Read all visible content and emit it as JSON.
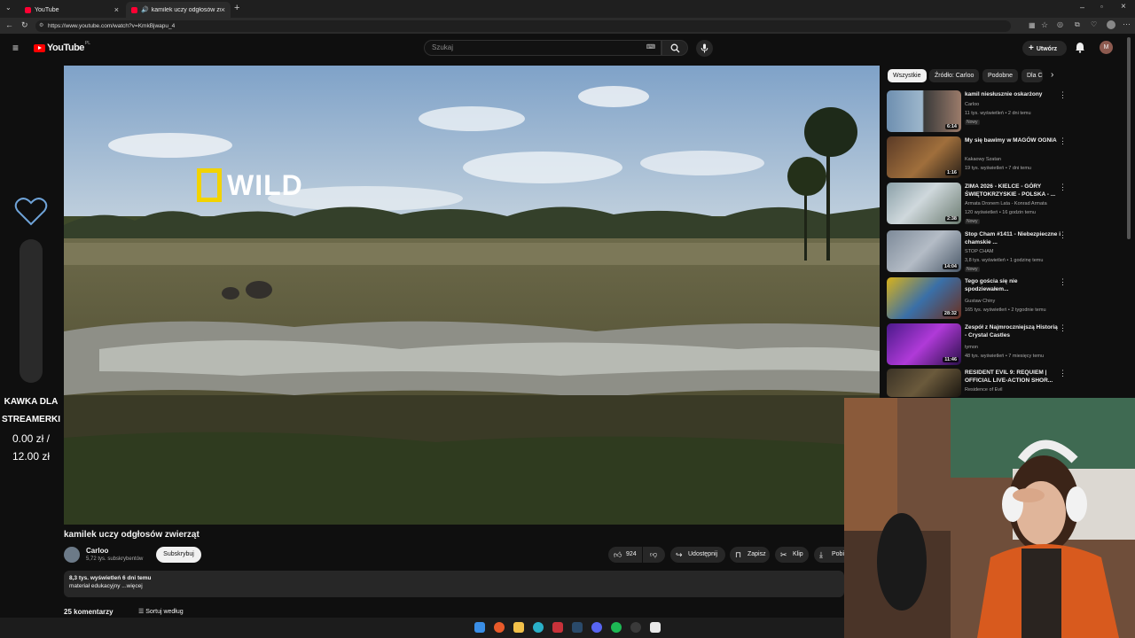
{
  "browser": {
    "tabs": [
      {
        "label": "YouTube"
      },
      {
        "label": "kamilek uczy odgłosów zwierz"
      }
    ],
    "url": "https://www.youtube.com/watch?v=KmkBjwapu_4"
  },
  "header": {
    "logo_text": "YouTube",
    "logo_country": "PL",
    "search_placeholder": "Szukaj",
    "create_label": "Utwórz",
    "avatar_letter": "M"
  },
  "overlay": {
    "line1": "KAWKA DLA",
    "line2": "STREAMERKI",
    "amount": "0.00 zł /",
    "goal": "12.00 zł"
  },
  "video": {
    "watermark": "WILD",
    "title": "kamilek uczy odgłosów zwierząt",
    "channel": "Carloo",
    "subscribers": "5,72 tys. subskrybentów",
    "subscribe_label": "Subskrybuj",
    "likes": "924",
    "share_label": "Udostępnij",
    "save_label": "Zapisz",
    "clip_label": "Klip",
    "download_label": "Pobi",
    "desc_stats": "8,3 tys. wyświetleń  6 dni temu",
    "desc_text": "materiał edukacyjny ...więcej",
    "comments": "25 komentarzy",
    "sort_label": "Sortuj według"
  },
  "chips": [
    "Wszystkie",
    "Źródło: Carloo",
    "Podobne",
    "Dla C"
  ],
  "recommended": [
    {
      "title": "kamil niesłusznie oskarżony",
      "channel": "Carloo",
      "meta": "11 tys. wyświetleń • 2 dni temu",
      "badge": "Nowy",
      "duration": "6:14"
    },
    {
      "title": "My się bawimy w MAGÓW OGNIA",
      "channel": "Kakaowy Szatan",
      "meta": "19 tys. wyświetleń • 7 dni temu",
      "badge": "",
      "duration": "1:16"
    },
    {
      "title": "ZIMA 2026 - KIELCE - GÓRY ŚWIĘTOKRZYSKIE - POLSKA - ...",
      "channel": "Armata Dronem Lata - Konrad Armata",
      "meta": "120 wyświetleń • 16 godzin temu",
      "badge": "Nowy",
      "duration": "2:38"
    },
    {
      "title": "Stop Cham #1411 - Niebezpieczne i chamskie ...",
      "channel": "STOP CHAM",
      "meta": "3,8 tys. wyświetleń • 1 godzinę temu",
      "badge": "Nowy",
      "duration": "14:04"
    },
    {
      "title": "Tego gościa się nie spodziewałem...",
      "channel": "Gustaw Chiny",
      "meta": "165 tys. wyświetleń • 2 tygodnie temu",
      "badge": "",
      "duration": "28:32"
    },
    {
      "title": "Zespół z Najmroczniejszą Historią - Crystal Castles",
      "channel": "tymon",
      "meta": "48 tys. wyświetleń • 7 miesięcy temu",
      "badge": "",
      "duration": "11:46"
    },
    {
      "title": "RESIDENT EVIL 9: REQUIEM | OFFICIAL LIVE-ACTION SHOR...",
      "channel": "Residence of Evil",
      "meta": "",
      "badge": "",
      "duration": ""
    }
  ],
  "colors": {
    "accent": "#ff0000",
    "wild_yellow": "#f2d300",
    "background": "#0f0f0f"
  }
}
